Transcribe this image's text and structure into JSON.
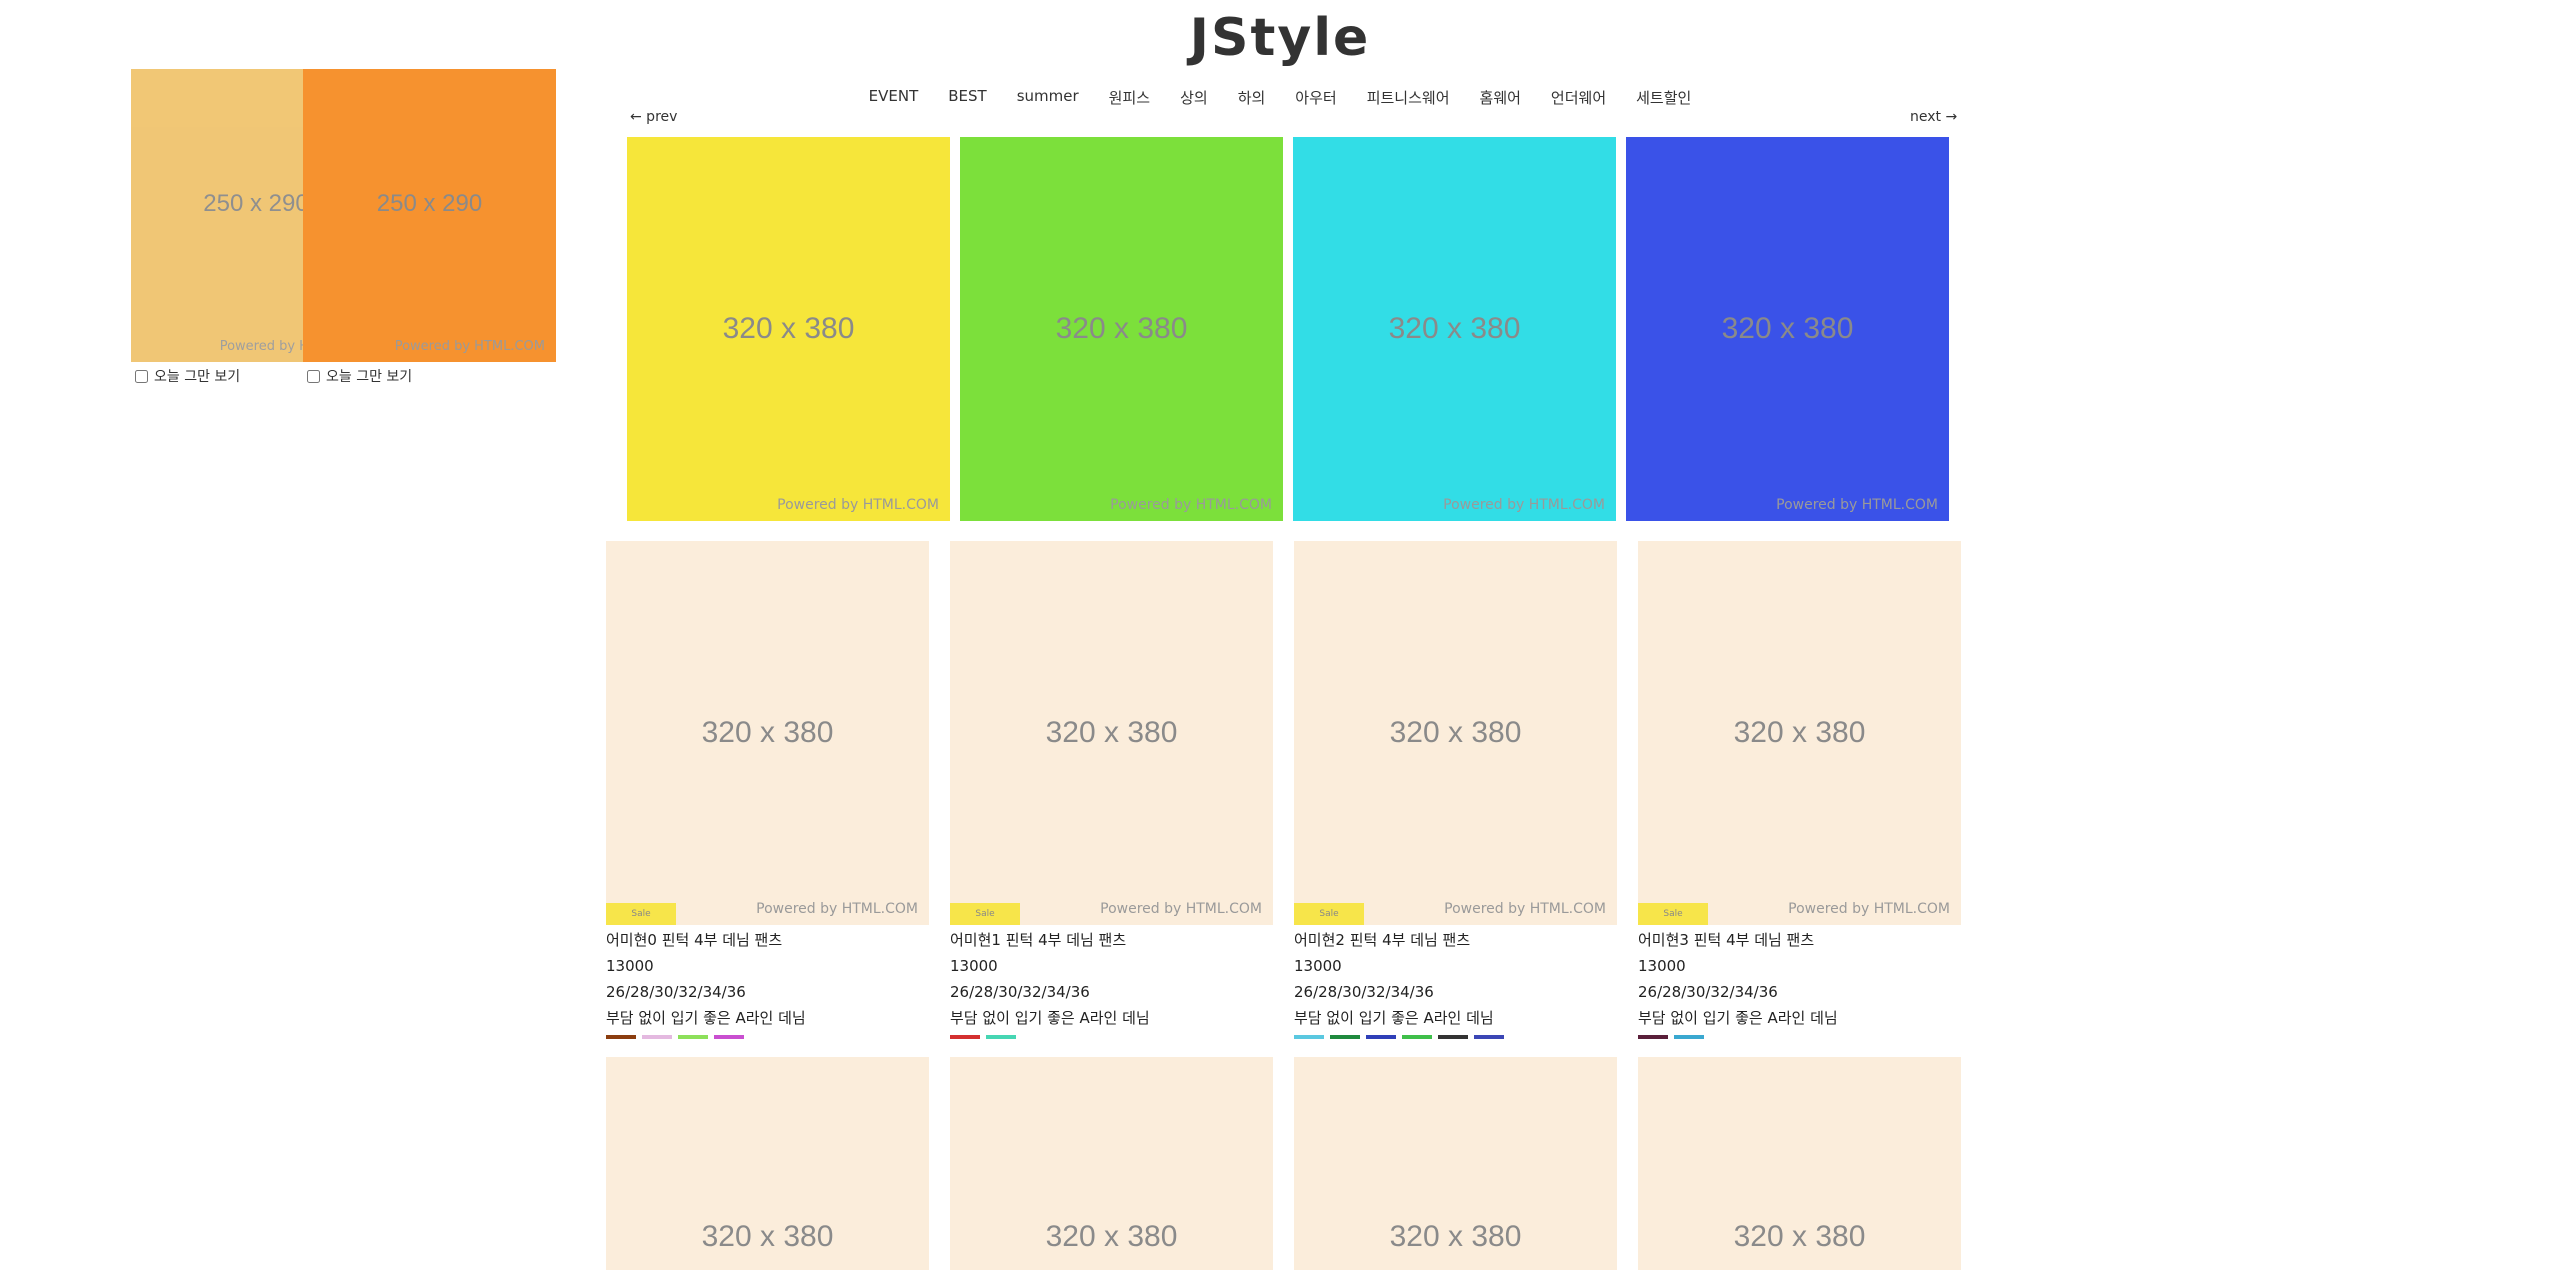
{
  "brand": {
    "logo": "JStyle"
  },
  "nav": {
    "items": [
      "EVENT",
      "BEST",
      "summer",
      "원피스",
      "상의",
      "하의",
      "아우터",
      "피트니스웨어",
      "홈웨어",
      "언더웨어",
      "세트할인"
    ]
  },
  "slider": {
    "prev_label": "← prev",
    "next_label": "next →",
    "slides": [
      {
        "label": "320 x 380",
        "powered": "Powered by HTML.COM",
        "color": "#f6e63a"
      },
      {
        "label": "320 x 380",
        "powered": "Powered by HTML.COM",
        "color": "#7ce03b"
      },
      {
        "label": "320 x 380",
        "powered": "Powered by HTML.COM",
        "color": "#32dde6"
      },
      {
        "label": "320 x 380",
        "powered": "Powered by HTML.COM",
        "color": "#3a52e8"
      }
    ]
  },
  "popups": [
    {
      "label": "250 x 290",
      "powered": "Powered by HTML.COM",
      "checkbox_label": "오늘 그만 보기",
      "color": "#f0c46e"
    },
    {
      "label": "250 x 290",
      "powered": "Powered by HTML.COM",
      "checkbox_label": "오늘 그만 보기",
      "color": "#f6922f"
    }
  ],
  "products": [
    {
      "image_label": "320 x 380",
      "powered": "Powered by HTML.COM",
      "name": "어미현0 핀턱 4부 데님 팬츠",
      "price": "13000",
      "sizes": "26/28/30/32/34/36",
      "desc": "부담 없이 입기 좋은 A라인 데님",
      "swatches": [
        "#8b3d0f",
        "#e4b9e0",
        "#8de05a",
        "#c94fd0"
      ]
    },
    {
      "image_label": "320 x 380",
      "powered": "Powered by HTML.COM",
      "name": "어미현1 핀턱 4부 데님 팬츠",
      "price": "13000",
      "sizes": "26/28/30/32/34/36",
      "desc": "부담 없이 입기 좋은 A라인 데님",
      "swatches": [
        "#d43030",
        "#46d6b3"
      ]
    },
    {
      "image_label": "320 x 380",
      "powered": "Powered by HTML.COM",
      "name": "어미현2 핀턱 4부 데님 팬츠",
      "price": "13000",
      "sizes": "26/28/30/32/34/36",
      "desc": "부담 없이 입기 좋은 A라인 데님",
      "swatches": [
        "#5ac8e0",
        "#1f8a3e",
        "#2f3fb8",
        "#3fbf4a",
        "#333333",
        "#3b46b5"
      ]
    },
    {
      "image_label": "320 x 380",
      "powered": "Powered by HTML.COM",
      "name": "어미현3 핀턱 4부 데님 팬츠",
      "price": "13000",
      "sizes": "26/28/30/32/34/36",
      "desc": "부담 없이 입기 좋은 A라인 데님",
      "swatches": [
        "#5a1f3a",
        "#3aa8d0"
      ]
    }
  ],
  "products_row2": [
    {
      "image_label": "320 x 380"
    },
    {
      "image_label": "320 x 380"
    },
    {
      "image_label": "320 x 380"
    },
    {
      "image_label": "320 x 380"
    }
  ],
  "colors": {
    "product_placeholder_bg": "#fbeddb"
  }
}
